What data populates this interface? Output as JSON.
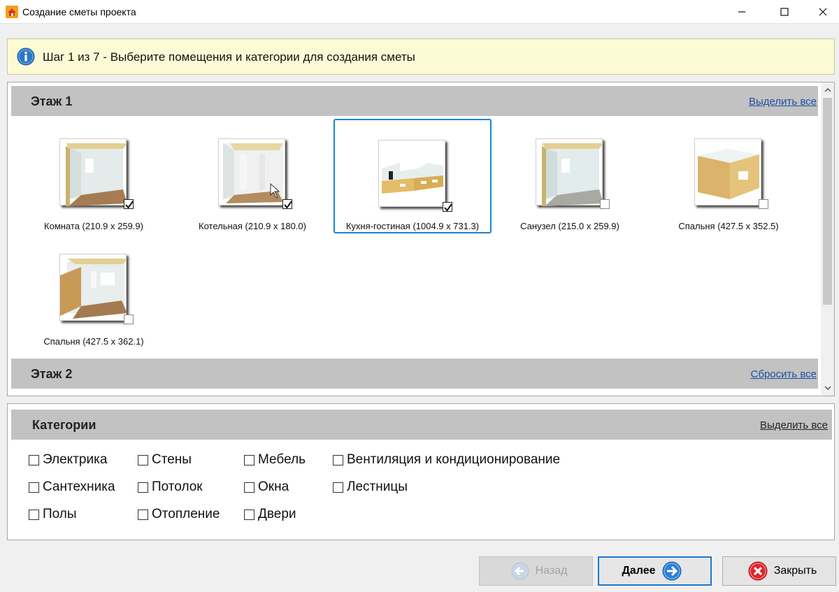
{
  "window": {
    "title": "Создание сметы проекта",
    "controls": [
      "minimize-icon",
      "maximize-icon",
      "close-icon"
    ]
  },
  "info": {
    "icon": "info-icon",
    "text": "Шаг 1 из 7 - Выберите помещения и категории для создания сметы"
  },
  "floors": [
    {
      "title": "Этаж 1",
      "action": "Выделить все",
      "rooms": [
        {
          "label": "Комната (210.9 x 259.9)",
          "checked": true,
          "selected": false
        },
        {
          "label": "Котельная (210.9 x 180.0)",
          "checked": true,
          "selected": false
        },
        {
          "label": "Кухня-гостиная (1004.9 x 731.3)",
          "checked": true,
          "selected": true
        },
        {
          "label": "Санузел (215.0 x 259.9)",
          "checked": false,
          "selected": false
        },
        {
          "label": "Спальня (427.5 x 352.5)",
          "checked": false,
          "selected": false
        },
        {
          "label": "Спальня (427.5 x 362.1)",
          "checked": false,
          "selected": false
        }
      ]
    },
    {
      "title": "Этаж 2",
      "action": "Сбросить все",
      "rooms": []
    }
  ],
  "categories": {
    "title": "Категории",
    "action": "Выделить все",
    "items": [
      {
        "label": "Электрика",
        "checked": false
      },
      {
        "label": "Сантехника",
        "checked": false
      },
      {
        "label": "Полы",
        "checked": false
      },
      {
        "label": "Стены",
        "checked": false
      },
      {
        "label": "Потолок",
        "checked": false
      },
      {
        "label": "Отопление",
        "checked": false
      },
      {
        "label": "Мебель",
        "checked": false
      },
      {
        "label": "Окна",
        "checked": false
      },
      {
        "label": "Двери",
        "checked": false
      },
      {
        "label": "Вентиляция и кондиционирование",
        "checked": false
      },
      {
        "label": "Лестницы",
        "checked": false
      }
    ]
  },
  "buttons": {
    "back": {
      "label": "Назад",
      "icon": "arrow-left-icon",
      "enabled": false
    },
    "next": {
      "label": "Далее",
      "icon": "arrow-right-icon",
      "enabled": true
    },
    "close": {
      "label": "Закрыть",
      "icon": "close-circle-icon",
      "enabled": true
    }
  },
  "colors": {
    "accent": "#1a86d0",
    "header": "#c2c2c2",
    "info_bg": "#fdfbd5",
    "link": "#1f4fa3"
  }
}
